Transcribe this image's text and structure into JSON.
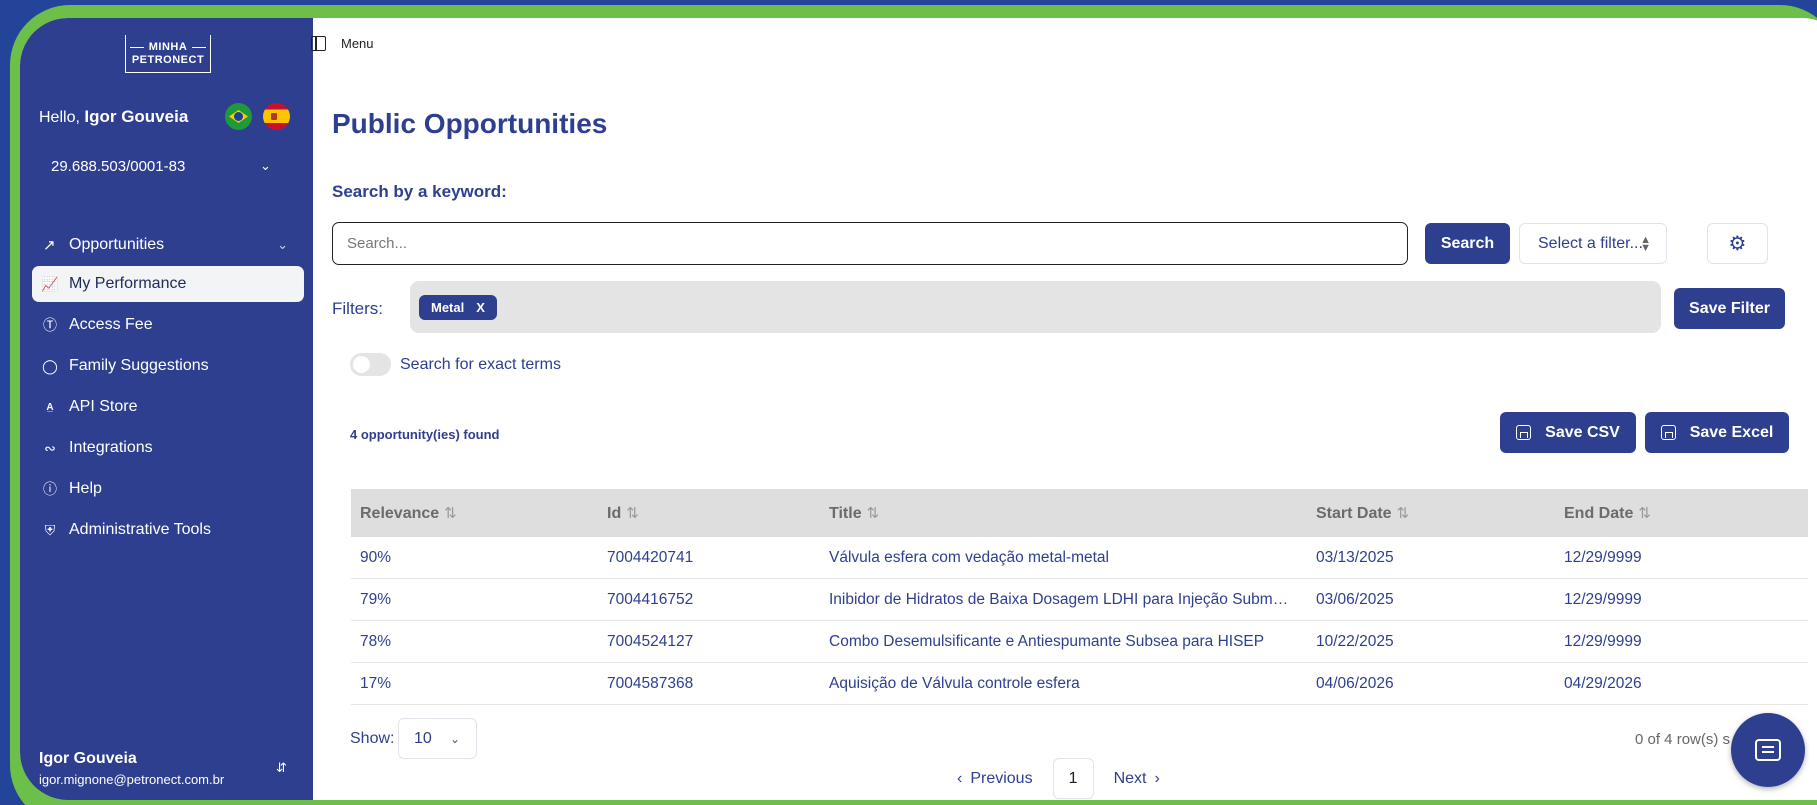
{
  "sidebar": {
    "logo_line1": "MINHA",
    "logo_line2": "PETRONECT",
    "greeting": "Hello,",
    "user_first": "Igor Gouveia",
    "cnpj": "29.688.503/0001-83",
    "nav_group": "Opportunities",
    "items": [
      {
        "label": "My Performance",
        "icon": "chart-icon"
      },
      {
        "label": "Access Fee",
        "icon": "dollar-icon"
      },
      {
        "label": "Family Suggestions",
        "icon": "lightbulb-icon"
      },
      {
        "label": "API Store",
        "icon": "api-icon"
      },
      {
        "label": "Integrations",
        "icon": "workflow-icon"
      },
      {
        "label": "Help",
        "icon": "help-icon"
      },
      {
        "label": "Administrative Tools",
        "icon": "shield-icon"
      }
    ],
    "user_name": "Igor Gouveia",
    "user_email": "igor.mignone@petronect.com.br"
  },
  "topbar": {
    "menu_label": "Menu"
  },
  "main": {
    "title": "Public Opportunities",
    "keyword_label": "Search by a keyword:",
    "search_placeholder": "Search...",
    "search_button": "Search",
    "filter_select": "Select a filter...",
    "filters_label": "Filters:",
    "active_filter": "Metal",
    "active_filter_remove": "X",
    "save_filter": "Save Filter",
    "exact_terms": "Search for exact terms",
    "found": "4 opportunity(ies) found",
    "save_csv": "Save CSV",
    "save_excel": "Save Excel"
  },
  "table": {
    "headers": [
      "Relevance",
      "Id",
      "Title",
      "Start Date",
      "End Date"
    ],
    "rows": [
      [
        "90%",
        "7004420741",
        "Válvula esfera com vedação metal-metal",
        "03/13/2025",
        "12/29/9999"
      ],
      [
        "79%",
        "7004416752",
        "Inibidor de Hidratos de Baixa Dosagem LDHI para Injeção Submarina",
        "03/06/2025",
        "12/29/9999"
      ],
      [
        "78%",
        "7004524127",
        "Combo Desemulsificante e Antiespumante Subsea para HISEP",
        "10/22/2025",
        "12/29/9999"
      ],
      [
        "17%",
        "7004587368",
        "Aquisição de Válvula controle esfera",
        "04/06/2026",
        "04/29/2026"
      ]
    ]
  },
  "footer": {
    "show_label": "Show:",
    "show_value": "10",
    "row_count": "0 of 4 row(s) s",
    "prev": "Previous",
    "page": "1",
    "next": "Next"
  },
  "colors": {
    "brand": "#2e3f8f",
    "frame": "#6cc04a",
    "background": "#24449a"
  }
}
